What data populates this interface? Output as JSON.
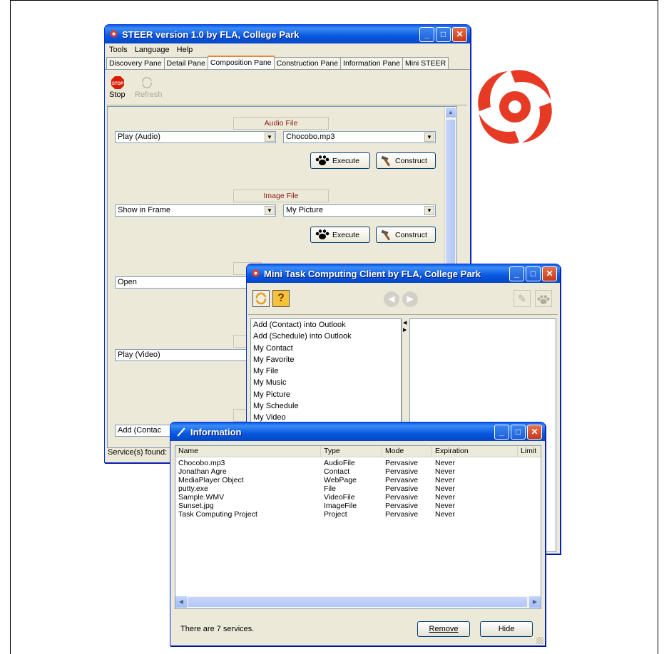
{
  "steer": {
    "title": "STEER version 1.0 by FLA, College Park",
    "menu": [
      "Tools",
      "Language",
      "Help"
    ],
    "tabs": [
      "Discovery Pane",
      "Detail Pane",
      "Composition Pane",
      "Construction Pane",
      "Information Pane",
      "Mini STEER"
    ],
    "active_tab": "Composition Pane",
    "toolbar": {
      "stop_label": "Stop",
      "refresh_label": "Refresh",
      "stop_icon_text": "STOP"
    },
    "groups": [
      {
        "label": "Audio File",
        "action": "Play (Audio)",
        "target": "Chocobo.mp3"
      },
      {
        "label": "Image File",
        "action": "Show in Frame",
        "target": "My Picture"
      }
    ],
    "execute_label": "Execute",
    "construct_label": "Construct",
    "hidden_rows": [
      "Open",
      "Play (Video)",
      "Add (Contac"
    ],
    "status": "Service(s) found:"
  },
  "mini": {
    "title": "Mini Task Computing Client by FLA, College Park",
    "help_icon_text": "?",
    "items": [
      "Add (Contact) into Outlook",
      "Add (Schedule) into Outlook",
      "My Contact",
      "My Favorite",
      "My File",
      "My Music",
      "My Picture",
      "My Schedule",
      "My Video"
    ]
  },
  "info": {
    "title": "Information",
    "columns": [
      "Name",
      "Type",
      "Mode",
      "Expiration",
      "Limit"
    ],
    "rows": [
      [
        "Chocobo.mp3",
        "AudioFile",
        "Pervasive",
        "Never"
      ],
      [
        "Jonathan Agre",
        "Contact",
        "Pervasive",
        "Never"
      ],
      [
        "MediaPlayer Object",
        "WebPage",
        "Pervasive",
        "Never"
      ],
      [
        "putty.exe",
        "File",
        "Pervasive",
        "Never"
      ],
      [
        "Sample.WMV",
        "VideoFile",
        "Pervasive",
        "Never"
      ],
      [
        "Sunset.jpg",
        "ImageFile",
        "Pervasive",
        "Never"
      ],
      [
        "Task Computing Project",
        "Project",
        "Pervasive",
        "Never"
      ]
    ],
    "status": "There are 7 services.",
    "remove_label": "Remove",
    "hide_label": "Hide"
  },
  "colors": {
    "xp_title_blue": "#0857e0",
    "close_red": "#c8391a",
    "logo_red": "#e63a25",
    "label_red": "#8b1a1a"
  }
}
